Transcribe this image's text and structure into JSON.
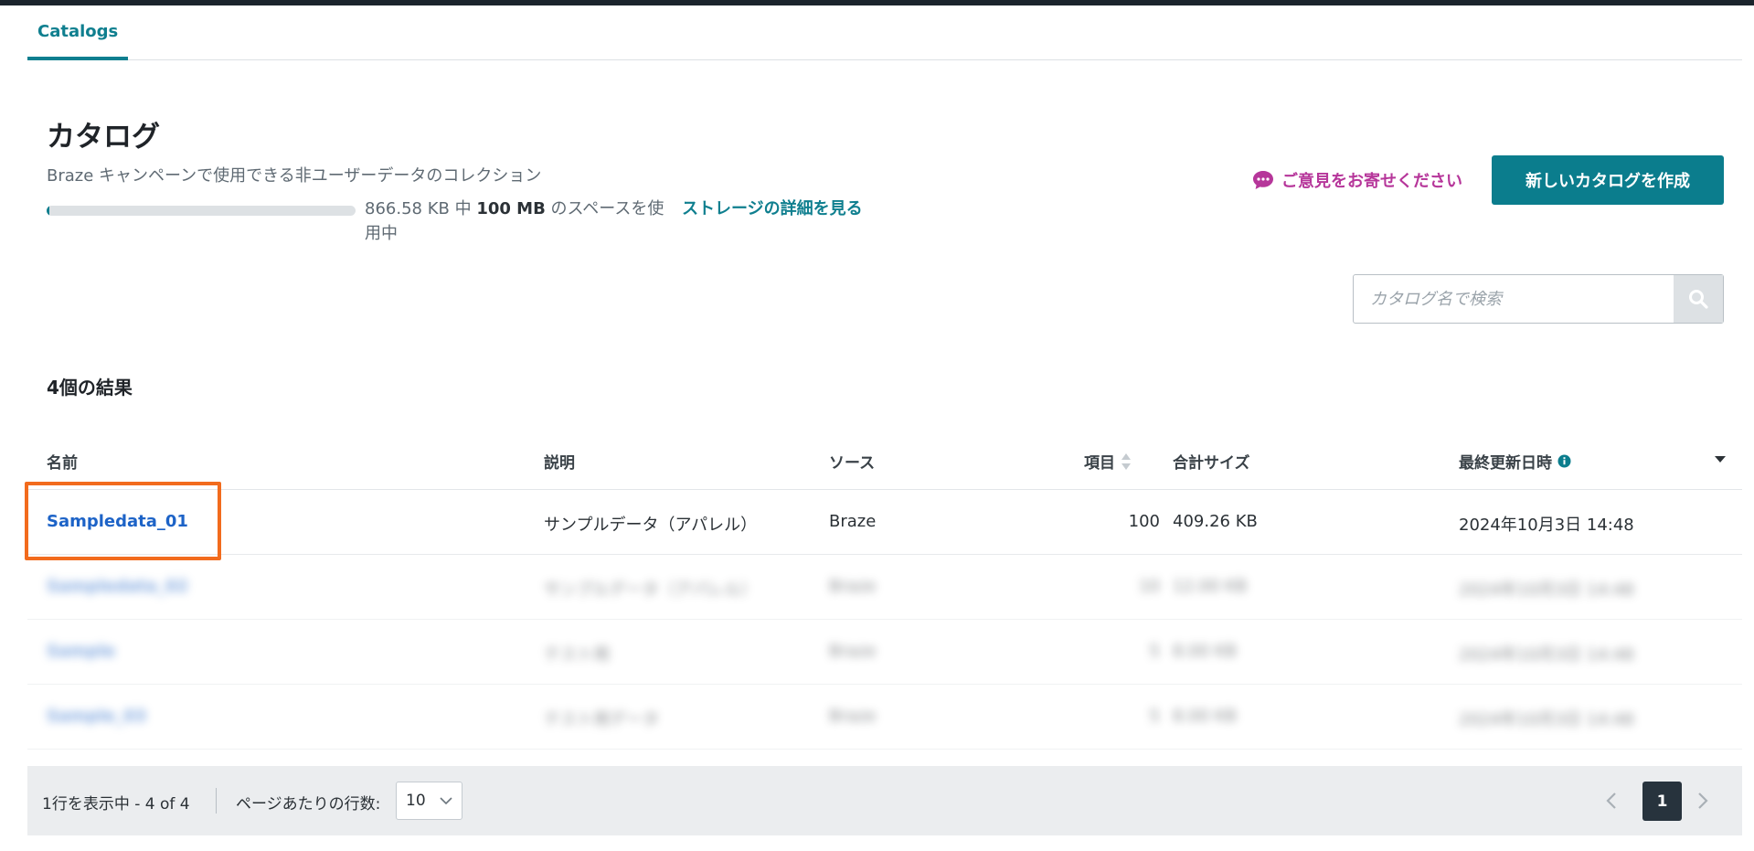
{
  "tabs": [
    {
      "label": "Catalogs"
    }
  ],
  "header": {
    "title": "カタログ",
    "subtitle": "Braze キャンペーンで使用できる非ユーザーデータのコレクション",
    "storage": {
      "used": "866.58 KB",
      "middle": " 中 ",
      "limit": "100 MB",
      "suffix": " のスペースを使用中",
      "used_fraction": 0.0087,
      "link": "ストレージの詳細を見る"
    },
    "feedback_label": "ご意見をお寄せください",
    "create_button": "新しいカタログを作成"
  },
  "search": {
    "placeholder": "カタログ名で検索"
  },
  "results_label": "4個の結果",
  "table": {
    "columns": {
      "name": "名前",
      "description": "説明",
      "source": "ソース",
      "items": "項目",
      "total_size": "合計サイズ",
      "last_updated": "最終更新日時"
    },
    "rows": [
      {
        "name": "Sampledata_01",
        "description": "サンプルデータ（アパレル）",
        "source": "Braze",
        "items": "100",
        "size": "409.26 KB",
        "updated": "2024年10月3日 14:48"
      },
      {
        "name": "Sampledata_02",
        "description": "サンプルデータ（アパレル）",
        "source": "Braze",
        "items": "10",
        "size": "12.00 KB",
        "updated": "2024年10月3日 14:48"
      },
      {
        "name": "Sample",
        "description": "テスト用",
        "source": "Braze",
        "items": "5",
        "size": "8.00 KB",
        "updated": "2024年10月3日 14:48"
      },
      {
        "name": "Sample_03",
        "description": "テスト用データ",
        "source": "Braze",
        "items": "5",
        "size": "8.00 KB",
        "updated": "2024年10月3日 14:48"
      }
    ]
  },
  "footer": {
    "range": "1行を表示中 - 4 of 4",
    "rows_per_page_label": "ページあたりの行数:",
    "rows_per_page": "10",
    "current_page": "1"
  },
  "colors": {
    "accent": "#0b7d8d",
    "link": "#1d63c7",
    "feedback": "#b6369a",
    "highlight": "#f26b1d"
  }
}
